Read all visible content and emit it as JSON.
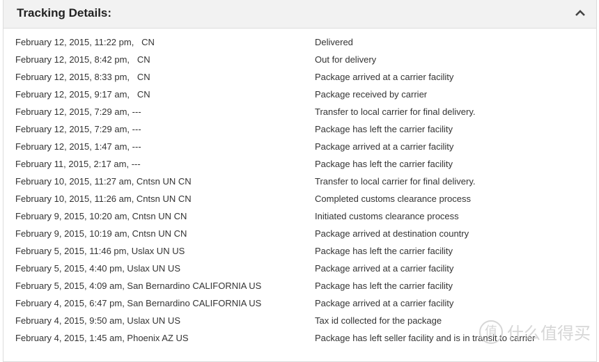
{
  "header": {
    "title": "Tracking Details:",
    "collapse_icon": "chevron-up-icon"
  },
  "events": [
    {
      "datetime": "February 12, 2015, 11:22 pm,   CN",
      "status": "Delivered"
    },
    {
      "datetime": "February 12, 2015, 8:42 pm,   CN",
      "status": "Out for delivery"
    },
    {
      "datetime": "February 12, 2015, 8:33 pm,   CN",
      "status": "Package arrived at a carrier facility"
    },
    {
      "datetime": "February 12, 2015, 9:17 am,   CN",
      "status": "Package received by carrier"
    },
    {
      "datetime": "February 12, 2015, 7:29 am, ---",
      "status": "Transfer to local carrier for final delivery."
    },
    {
      "datetime": "February 12, 2015, 7:29 am, ---",
      "status": "Package has left the carrier facility"
    },
    {
      "datetime": "February 12, 2015, 1:47 am, ---",
      "status": "Package arrived at a carrier facility"
    },
    {
      "datetime": "February 11, 2015, 2:17 am, ---",
      "status": "Package has left the carrier facility"
    },
    {
      "datetime": "February 10, 2015, 11:27 am, Cntsn UN CN",
      "status": "Transfer to local carrier for final delivery."
    },
    {
      "datetime": "February 10, 2015, 11:26 am, Cntsn UN CN",
      "status": "Completed customs clearance process"
    },
    {
      "datetime": "February 9, 2015, 10:20 am, Cntsn UN CN",
      "status": "Initiated customs clearance process"
    },
    {
      "datetime": "February 9, 2015, 10:19 am, Cntsn UN CN",
      "status": "Package arrived at destination country"
    },
    {
      "datetime": "February 5, 2015, 11:46 pm, Uslax UN US",
      "status": "Package has left the carrier facility"
    },
    {
      "datetime": "February 5, 2015, 4:40 pm, Uslax UN US",
      "status": "Package arrived at a carrier facility"
    },
    {
      "datetime": "February 5, 2015, 4:09 am, San Bernardino CALIFORNIA US",
      "status": "Package has left the carrier facility"
    },
    {
      "datetime": "February 4, 2015, 6:47 pm, San Bernardino CALIFORNIA US",
      "status": "Package arrived at a carrier facility"
    },
    {
      "datetime": "February 4, 2015, 9:50 am, Uslax UN US",
      "status": "Tax id collected for the package"
    },
    {
      "datetime": "February 4, 2015, 1:45 am, Phoenix AZ US",
      "status": "Package has left seller facility and is in transit to carrier"
    }
  ],
  "watermark": {
    "badge": "值",
    "text": "什么值得买"
  }
}
